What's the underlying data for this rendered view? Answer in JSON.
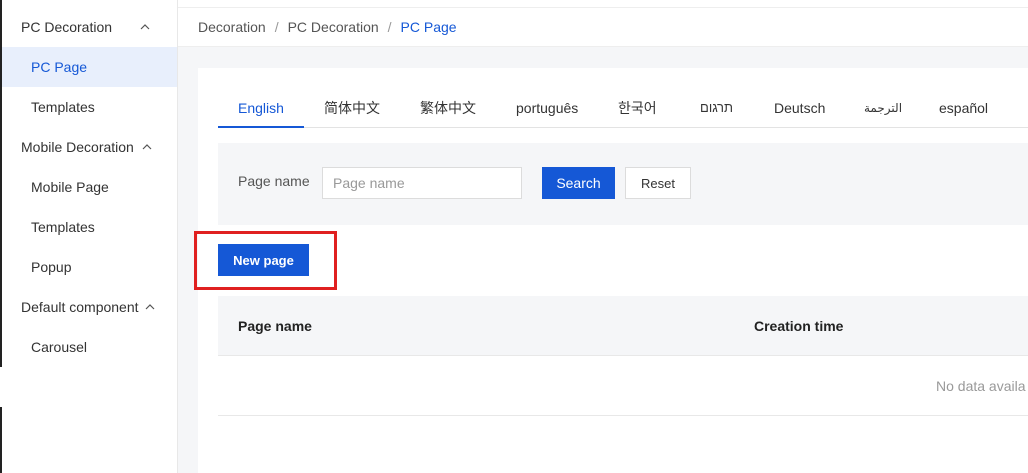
{
  "sidebar": {
    "groups": [
      {
        "title": "PC Decoration",
        "items": [
          "PC Page",
          "Templates"
        ]
      },
      {
        "title": "Mobile Decoration",
        "items": [
          "Mobile Page",
          "Templates",
          "Popup"
        ]
      },
      {
        "title": "Default component",
        "items": [
          "Carousel"
        ]
      }
    ]
  },
  "breadcrumb": [
    "Decoration",
    "PC Decoration",
    "PC Page"
  ],
  "tabs": [
    "English",
    "简体中文",
    "繁体中文",
    "português",
    "한국어",
    "תרגום",
    "Deutsch",
    "الترجمة",
    "español"
  ],
  "search": {
    "label": "Page name",
    "placeholder": "Page name",
    "value": "",
    "search_button": "Search",
    "reset_button": "Reset"
  },
  "new_page_button": "New page",
  "table": {
    "columns": [
      "Page name",
      "Creation time"
    ],
    "empty_text": "No data availa"
  },
  "colors": {
    "accent": "#1558d6",
    "highlight": "#e02020",
    "active_bg": "#e8effc"
  }
}
